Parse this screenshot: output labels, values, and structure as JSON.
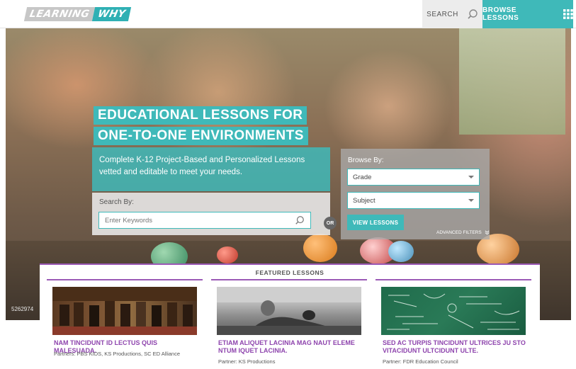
{
  "header": {
    "logo_left": "LEARNING",
    "logo_right": "WHY",
    "search_label": "SEARCH",
    "browse_label": "BROWSE LESSONS"
  },
  "hero": {
    "headline_line1": "EDUCATIONAL LESSONS FOR",
    "headline_line2": "ONE-TO-ONE ENVIRONMENTS",
    "subtext": "Complete K-12 Project-Based and Personalized Lessons vetted and editable to meet your needs.",
    "image_code": "5262974"
  },
  "search": {
    "label": "Search By:",
    "placeholder": "Enter Keywords",
    "or_label": "OR"
  },
  "browse": {
    "label": "Browse By:",
    "grade_value": "Grade",
    "subject_value": "Subject",
    "view_button": "VIEW LESSONS",
    "advanced_filters": "ADVANCED FILTERS"
  },
  "featured": {
    "title": "FEATURED LESSONS",
    "cards": [
      {
        "title": "NAM TINCIDUNT ID LECTUS QUIS MALESUADA.",
        "partners": "Partners: PBS KIDS, KS Productions, SC ED Alliance"
      },
      {
        "title": "ETIAM ALIQUET LACINIA MAG NAUT ELEME NTUM IQUET LACINIA.",
        "partners": "Partner: KS Productions"
      },
      {
        "title": "SED AC TURPIS TINCIDUNT ULTRICES JU STO VITACIDUNT ULTCIDUNT ULTE.",
        "partners": "Partner: FDR Education Council"
      }
    ]
  },
  "colors": {
    "teal": "#3fb9b9",
    "purple": "#9b59b6",
    "card_title": "#8e44ad"
  },
  "icons": {
    "search": "search-icon",
    "grid": "grid-icon",
    "caret": "chevron-down-icon"
  }
}
